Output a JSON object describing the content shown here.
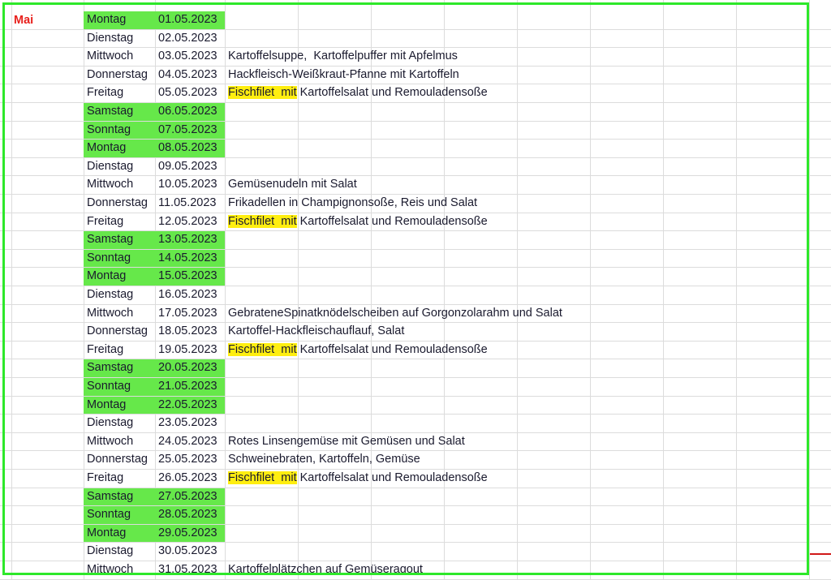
{
  "month_label": "Mai",
  "colors": {
    "weekend_highlight": "#66e84a",
    "fischfilet_highlight": "#ffee10",
    "month_label": "#e8201c",
    "frame": "#2ee82a"
  },
  "rows": [
    {
      "day": "Montag",
      "date": "01.05.2023",
      "meal": "",
      "green": true
    },
    {
      "day": "Dienstag",
      "date": "02.05.2023",
      "meal": "",
      "green": false
    },
    {
      "day": "Mittwoch",
      "date": "03.05.2023",
      "meal": "Kartoffelsuppe,  Kartoffelpuffer mit Apfelmus",
      "green": false
    },
    {
      "day": "Donnerstag",
      "date": "04.05.2023",
      "meal": "Hackfleisch-Weißkraut-Pfanne mit Kartoffeln",
      "green": false
    },
    {
      "day": "Freitag",
      "date": "05.05.2023",
      "meal_highlight": "Fischfilet  mit",
      "meal": " Kartoffelsalat und Remouladensoße",
      "green": false
    },
    {
      "day": "Samstag",
      "date": "06.05.2023",
      "meal": "",
      "green": true
    },
    {
      "day": "Sonntag",
      "date": "07.05.2023",
      "meal": "",
      "green": true
    },
    {
      "day": "Montag",
      "date": "08.05.2023",
      "meal": "",
      "green": true
    },
    {
      "day": "Dienstag",
      "date": "09.05.2023",
      "meal": "",
      "green": false
    },
    {
      "day": "Mittwoch",
      "date": "10.05.2023",
      "meal": "Gemüsenudeln mit Salat",
      "green": false
    },
    {
      "day": "Donnerstag",
      "date": "11.05.2023",
      "meal": "Frikadellen in Champignonsoße, Reis und Salat",
      "green": false
    },
    {
      "day": "Freitag",
      "date": "12.05.2023",
      "meal_highlight": "Fischfilet  mit",
      "meal": " Kartoffelsalat und Remouladensoße",
      "green": false
    },
    {
      "day": "Samstag",
      "date": "13.05.2023",
      "meal": "",
      "green": true
    },
    {
      "day": "Sonntag",
      "date": "14.05.2023",
      "meal": "",
      "green": true
    },
    {
      "day": "Montag",
      "date": "15.05.2023",
      "meal": "",
      "green": true
    },
    {
      "day": "Dienstag",
      "date": "16.05.2023",
      "meal": "",
      "green": false
    },
    {
      "day": "Mittwoch",
      "date": "17.05.2023",
      "meal": "GebrateneSpinatknödelscheiben auf Gorgonzolarahm und Salat",
      "green": false
    },
    {
      "day": "Donnerstag",
      "date": "18.05.2023",
      "meal": "Kartoffel-Hackfleischauflauf, Salat",
      "green": false
    },
    {
      "day": "Freitag",
      "date": "19.05.2023",
      "meal_highlight": "Fischfilet  mit",
      "meal": " Kartoffelsalat und Remouladensoße",
      "green": false
    },
    {
      "day": "Samstag",
      "date": "20.05.2023",
      "meal": "",
      "green": true
    },
    {
      "day": "Sonntag",
      "date": "21.05.2023",
      "meal": "",
      "green": true
    },
    {
      "day": "Montag",
      "date": "22.05.2023",
      "meal": "",
      "green": true
    },
    {
      "day": "Dienstag",
      "date": "23.05.2023",
      "meal": "",
      "green": false
    },
    {
      "day": "Mittwoch",
      "date": "24.05.2023",
      "meal": "Rotes Linsengemüse mit Gemüsen und Salat",
      "green": false
    },
    {
      "day": "Donnerstag",
      "date": "25.05.2023",
      "meal": "Schweinebraten, Kartoffeln, Gemüse",
      "green": false
    },
    {
      "day": "Freitag",
      "date": "26.05.2023",
      "meal_highlight": "Fischfilet  mit",
      "meal": " Kartoffelsalat und Remouladensoße",
      "green": false
    },
    {
      "day": "Samstag",
      "date": "27.05.2023",
      "meal": "",
      "green": true
    },
    {
      "day": "Sonntag",
      "date": "28.05.2023",
      "meal": "",
      "green": true
    },
    {
      "day": "Montag",
      "date": "29.05.2023",
      "meal": "",
      "green": true
    },
    {
      "day": "Dienstag",
      "date": "30.05.2023",
      "meal": "",
      "green": false
    },
    {
      "day": "Mittwoch",
      "date": "31.05.2023",
      "meal": "Kartoffelplätzchen auf Gemüseragout",
      "green": false
    }
  ]
}
